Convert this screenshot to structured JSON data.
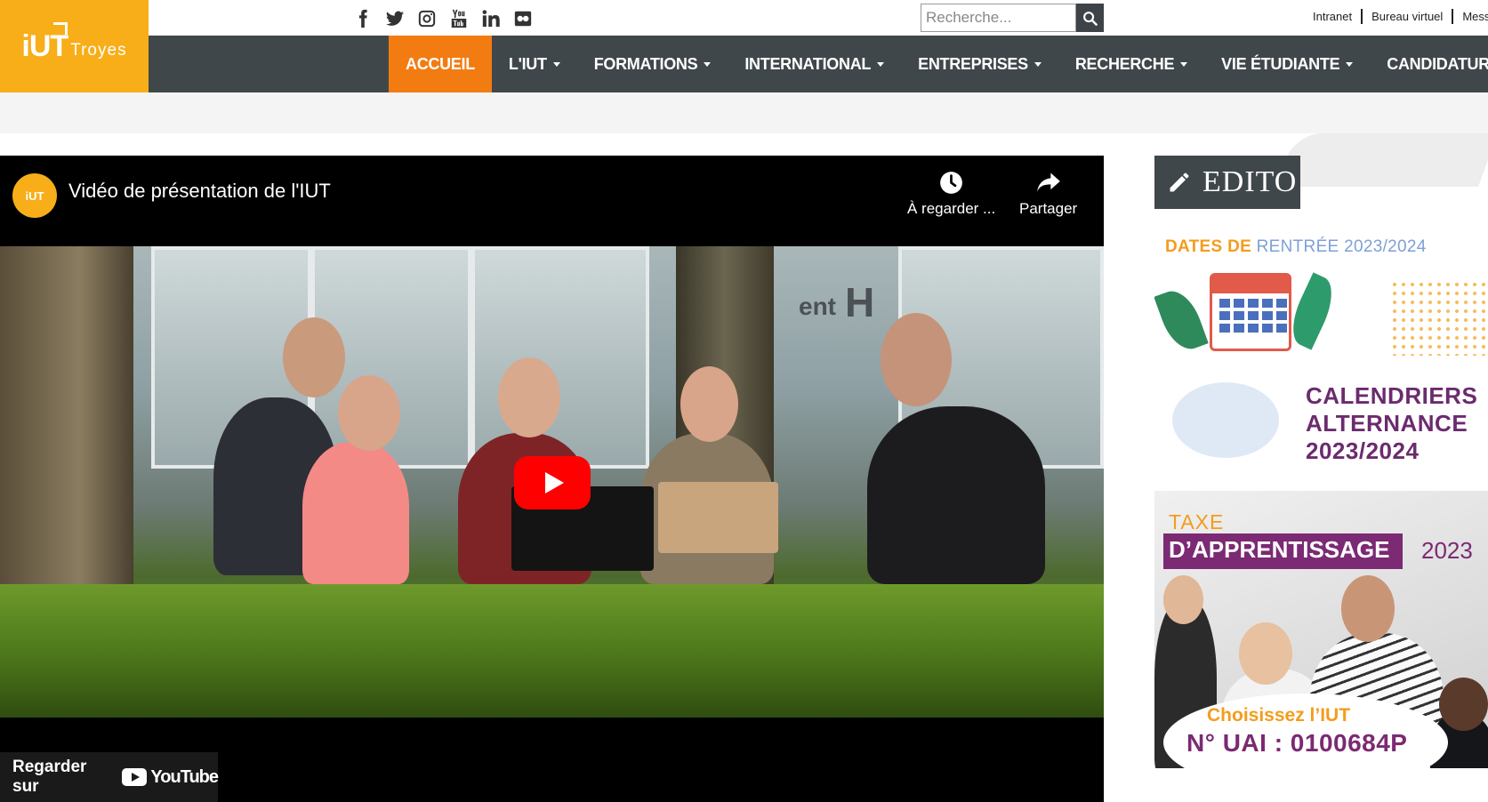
{
  "header": {
    "logo": {
      "main": "iUT",
      "sub": "Troyes"
    },
    "social_icons": [
      "facebook-icon",
      "twitter-icon",
      "instagram-icon",
      "youtube-icon",
      "linkedin-icon",
      "flickr-icon"
    ],
    "search": {
      "placeholder": "Recherche..."
    },
    "top_links": [
      "Intranet",
      "Bureau virtuel",
      "Mess"
    ]
  },
  "nav": {
    "items": [
      {
        "label": "ACCUEIL",
        "active": true,
        "dropdown": false
      },
      {
        "label": "L'IUT",
        "dropdown": true
      },
      {
        "label": "FORMATIONS",
        "dropdown": true
      },
      {
        "label": "INTERNATIONAL",
        "dropdown": true
      },
      {
        "label": "ENTREPRISES",
        "dropdown": true
      },
      {
        "label": "RECHERCHE",
        "dropdown": true
      },
      {
        "label": "VIE ÉTUDIANTE",
        "dropdown": true
      },
      {
        "label": "CANDIDATUR",
        "dropdown": false
      }
    ]
  },
  "video": {
    "channel_avatar": "iUT",
    "title": "Vidéo de présentation de l'IUT",
    "watch_later": "À regarder ...",
    "share": "Partager",
    "scene_sign": "ent",
    "scene_sign_h": "H",
    "watch_on": "Regarder sur",
    "youtube": "YouTube"
  },
  "sidebar": {
    "edito": "EDITO",
    "card1": {
      "part1": "DATES DE ",
      "part2": "RENTRÉE 2023/2024"
    },
    "card2": {
      "lines": [
        "CALENDRIERS",
        "ALTERNANCE",
        "2023/2024"
      ]
    },
    "card3": {
      "taxe": "TAXE",
      "apprentissage": "D’APPRENTISSAGE",
      "year": "2023",
      "choose": "Choisissez l’IUT",
      "uai": "N° UAI : 0100684P"
    }
  },
  "colors": {
    "brand_orange": "#f8ae19",
    "nav_active": "#f27c12",
    "nav_bg": "#40474b",
    "youtube_red": "#ff0000",
    "purple": "#7b2a73"
  }
}
